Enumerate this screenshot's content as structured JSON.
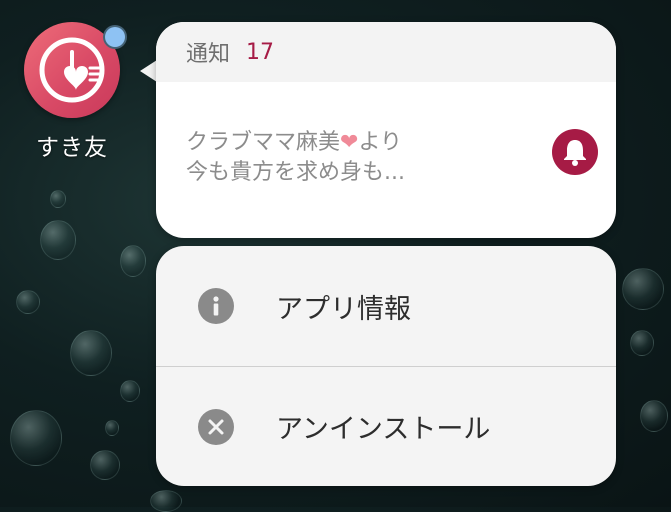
{
  "app": {
    "label": "すき友",
    "icon": "heart-clock-icon",
    "badge": "notification-dot",
    "colors": {
      "icon_bg": "#e05570",
      "badge": "#8ec2f3"
    }
  },
  "notification": {
    "title": "通知",
    "count": "17",
    "sender": "クラブママ麻美",
    "heart": "❤",
    "sender_suffix": "より",
    "message": "今も貴方を求め身も...",
    "action_icon": "bell-icon",
    "colors": {
      "accent": "#a61b45"
    }
  },
  "actions": [
    {
      "label": "アプリ情報",
      "icon": "info-icon"
    },
    {
      "label": "アンインストール",
      "icon": "close-icon"
    }
  ]
}
